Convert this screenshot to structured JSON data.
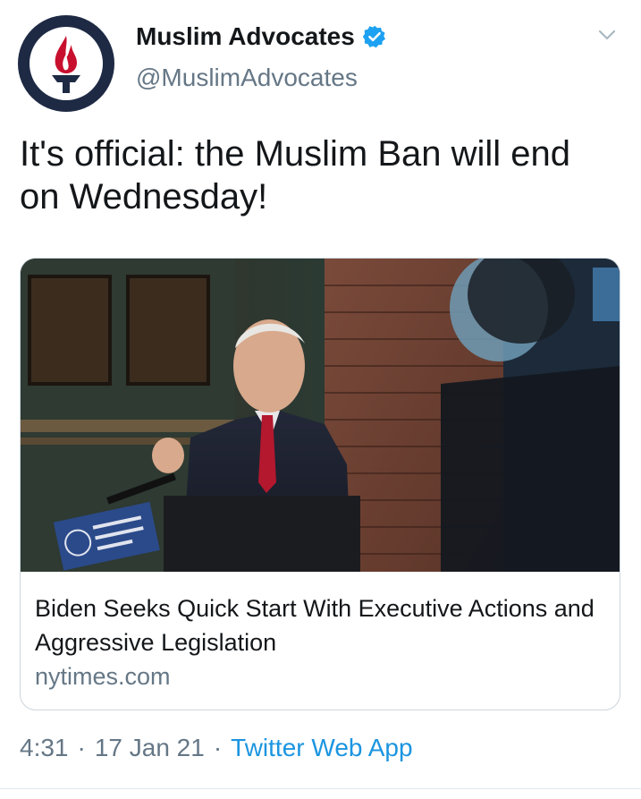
{
  "author": {
    "display_name": "Muslim Advocates",
    "handle": "@MuslimAdvocates",
    "verified": true,
    "avatar_icon": "torch-logo-icon",
    "brand_color": "#1e2a44",
    "accent_color": "#c8102e"
  },
  "tweet": {
    "text": "It's official: the Muslim Ban will end on Wednesday!"
  },
  "card": {
    "image_icon": "news-photo",
    "title": "Biden Seeks Quick Start With Executive Actions and Aggressive Legislation",
    "domain": "nytimes.com"
  },
  "footer": {
    "time": "4:31",
    "sep1": "·",
    "date": "17 Jan 21",
    "sep2": "·",
    "source": "Twitter Web App"
  },
  "colors": {
    "link": "#1b95e0",
    "secondary": "#657786",
    "verified": "#1da1f2"
  }
}
